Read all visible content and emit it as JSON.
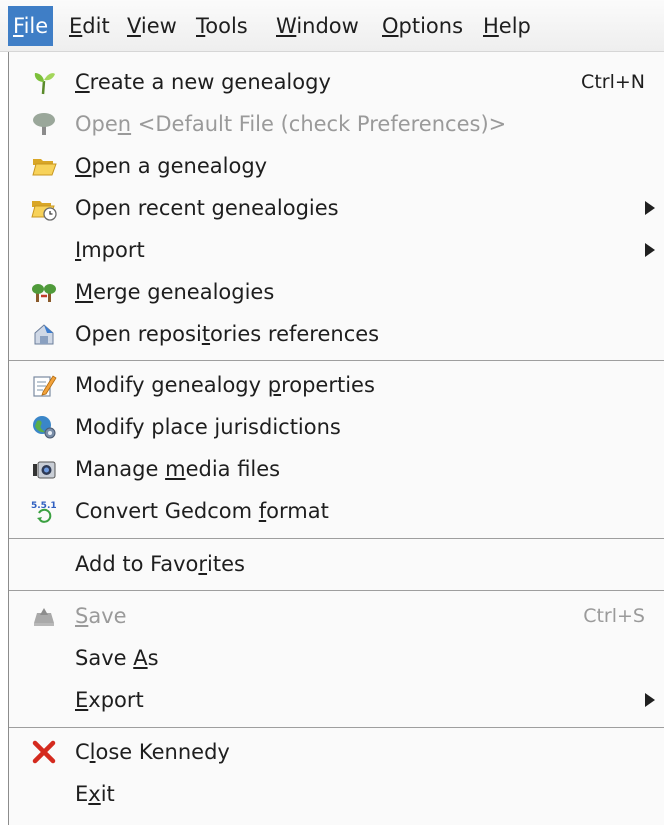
{
  "menubar": {
    "items": [
      {
        "pre": "",
        "u": "F",
        "post": "ile"
      },
      {
        "pre": "",
        "u": "E",
        "post": "dit"
      },
      {
        "pre": "",
        "u": "V",
        "post": "iew"
      },
      {
        "pre": "",
        "u": "T",
        "post": "ools"
      },
      {
        "pre": "",
        "u": "W",
        "post": "indow"
      },
      {
        "pre": "",
        "u": "O",
        "post": "ptions"
      },
      {
        "pre": "",
        "u": "H",
        "post": "elp"
      }
    ]
  },
  "file_menu": {
    "items": [
      {
        "pre": "",
        "u": "C",
        "post": "reate a new genealogy",
        "accel": "Ctrl+N",
        "icon": "sprout-icon"
      },
      {
        "pre": "Ope",
        "u": "n",
        "post": " <Default File (check Preferences)>",
        "icon": "tree-icon",
        "disabled": true
      },
      {
        "pre": "",
        "u": "O",
        "post": "pen a genealogy",
        "icon": "folder-open-icon"
      },
      {
        "pre": "Open recent genealogies",
        "u": "",
        "post": "",
        "icon": "folder-recent-icon",
        "submenu": true
      },
      {
        "pre": "",
        "u": "I",
        "post": "mport",
        "submenu": true
      },
      {
        "pre": "",
        "u": "M",
        "post": "erge genealogies",
        "icon": "merge-trees-icon"
      },
      {
        "pre": "Open reposi",
        "u": "t",
        "post": "ories references",
        "icon": "repository-icon"
      },
      {
        "pre": "Modify genealogy ",
        "u": "p",
        "post": "roperties",
        "icon": "edit-properties-icon"
      },
      {
        "pre": "Modify place jurisdictions",
        "u": "",
        "post": "",
        "icon": "globe-gear-icon"
      },
      {
        "pre": "Manage ",
        "u": "m",
        "post": "edia files",
        "icon": "camera-icon"
      },
      {
        "pre": "Convert Gedcom ",
        "u": "f",
        "post": "ormat",
        "icon": "gedcom-convert-icon"
      },
      {
        "pre": "Add to Favo",
        "u": "r",
        "post": "ites"
      },
      {
        "pre": "",
        "u": "S",
        "post": "ave",
        "accel": "Ctrl+S",
        "icon": "save-icon",
        "disabled": true
      },
      {
        "pre": "Save ",
        "u": "A",
        "post": "s"
      },
      {
        "pre": "",
        "u": "E",
        "post": "xport",
        "submenu": true
      },
      {
        "pre": "C",
        "u": "l",
        "post": "ose Kennedy",
        "icon": "close-x-icon"
      },
      {
        "pre": "E",
        "u": "x",
        "post": "it"
      }
    ]
  },
  "colors": {
    "menubar_active": "#3f7ec6",
    "disabled_text": "#9a9a9a"
  }
}
